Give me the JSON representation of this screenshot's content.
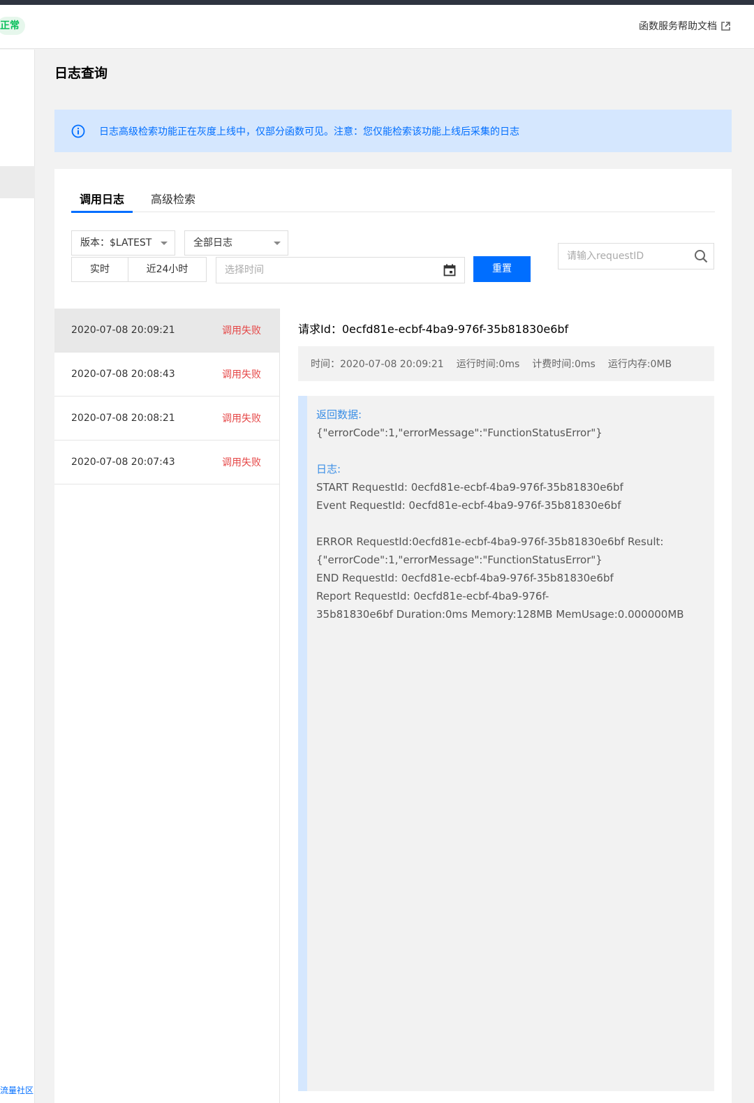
{
  "topbar": {
    "status_label": "正常",
    "help_link": "函数服务帮助文档"
  },
  "sidebar": {
    "community_link": "流量社区"
  },
  "page": {
    "title": "日志查询"
  },
  "notice": {
    "text": "日志高级检索功能正在灰度上线中，仅部分函数可见。注意：您仅能检索该功能上线后采集的日志"
  },
  "tabs": [
    {
      "label": "调用日志",
      "active": true
    },
    {
      "label": "高级检索",
      "active": false
    }
  ],
  "filters": {
    "version_select": "版本：$LATEST",
    "log_type_select": "全部日志",
    "realtime_button": "实时",
    "last24h_button": "近24小时",
    "time_placeholder": "选择时间",
    "reset_button": "重置",
    "request_search_placeholder": "请输入requestID"
  },
  "logs": [
    {
      "time": "2020-07-08 20:09:21",
      "status": "调用失败",
      "selected": true
    },
    {
      "time": "2020-07-08 20:08:43",
      "status": "调用失败",
      "selected": false
    },
    {
      "time": "2020-07-08 20:08:21",
      "status": "调用失败",
      "selected": false
    },
    {
      "time": "2020-07-08 20:07:43",
      "status": "调用失败",
      "selected": false
    }
  ],
  "detail": {
    "request_id": "请求Id：0ecfd81e-ecbf-4ba9-976f-35b81830e6bf",
    "meta": {
      "time": "时间：2020-07-08 20:09:21",
      "run_time": "运行时间:0ms",
      "billed_time": "计费时间:0ms",
      "memory": "运行内存:0MB"
    },
    "return_label": "返回数据:",
    "return_value": "{\"errorCode\":1,\"errorMessage\":\"FunctionStatusError\"}",
    "log_label": "日志:",
    "log_lines": [
      "START RequestId: 0ecfd81e-ecbf-4ba9-976f-35b81830e6bf",
      "Event RequestId: 0ecfd81e-ecbf-4ba9-976f-35b81830e6bf",
      "",
      "ERROR RequestId:0ecfd81e-ecbf-4ba9-976f-35b81830e6bf Result:",
      "{\"errorCode\":1,\"errorMessage\":\"FunctionStatusError\"}",
      "END RequestId: 0ecfd81e-ecbf-4ba9-976f-35b81830e6bf",
      "Report RequestId: 0ecfd81e-ecbf-4ba9-976f-",
      "35b81830e6bf Duration:0ms Memory:128MB MemUsage:0.000000MB"
    ]
  },
  "colors": {
    "accent": "#006eff",
    "error": "#e54545",
    "success": "#0abf5b"
  }
}
